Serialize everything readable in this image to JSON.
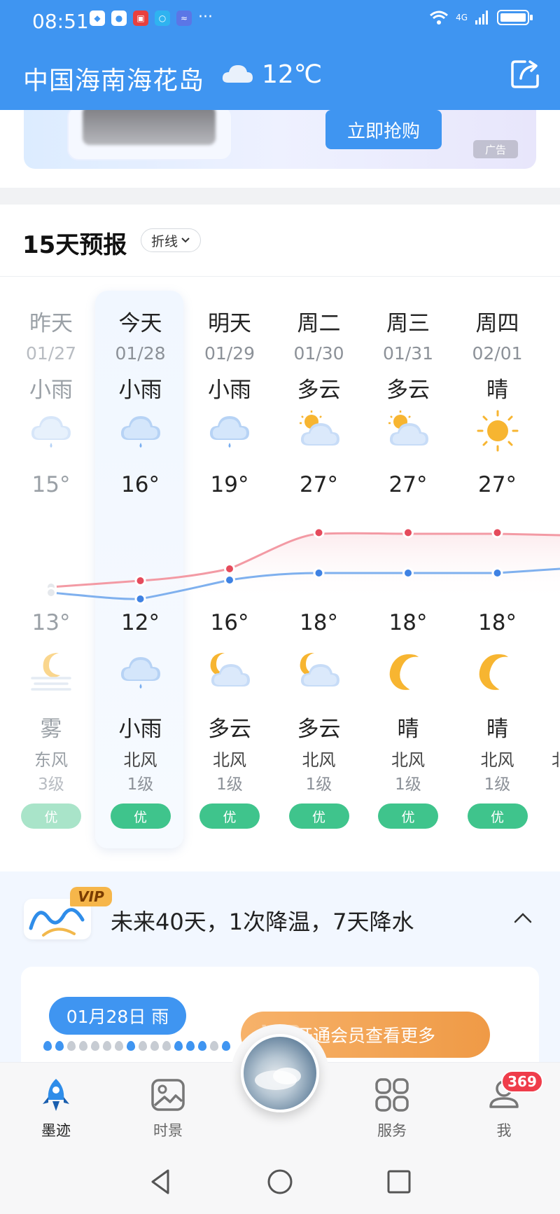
{
  "status_bar": {
    "time": "08:51",
    "network": "4G"
  },
  "header": {
    "location": "中国海南海花岛",
    "current_temp": "12℃",
    "weather_icon": "cloud-icon"
  },
  "ad": {
    "button": "立即抢购",
    "tag": "广告"
  },
  "forecast": {
    "title": "15天预报",
    "view_toggle": "折线",
    "days": [
      {
        "name": "昨天",
        "date": "01/27",
        "day_cond": "小雨",
        "day_icon": "rain-cloud-icon",
        "high": "15°",
        "low": "13°",
        "night_icon": "fog-moon-icon",
        "night_cond": "雾",
        "wind": "东风",
        "wind_level": "3级",
        "aqi": "优"
      },
      {
        "name": "今天",
        "date": "01/28",
        "day_cond": "小雨",
        "day_icon": "rain-cloud-icon",
        "high": "16°",
        "low": "12°",
        "night_icon": "rain-cloud-icon",
        "night_cond": "小雨",
        "wind": "北风",
        "wind_level": "1级",
        "aqi": "优"
      },
      {
        "name": "明天",
        "date": "01/29",
        "day_cond": "小雨",
        "day_icon": "rain-cloud-icon",
        "high": "19°",
        "low": "16°",
        "night_icon": "partly-cloudy-night-icon",
        "night_cond": "多云",
        "wind": "北风",
        "wind_level": "1级",
        "aqi": "优"
      },
      {
        "name": "周二",
        "date": "01/30",
        "day_cond": "多云",
        "day_icon": "partly-cloudy-day-icon",
        "high": "27°",
        "low": "18°",
        "night_icon": "partly-cloudy-night-icon",
        "night_cond": "多云",
        "wind": "北风",
        "wind_level": "1级",
        "aqi": "优"
      },
      {
        "name": "周三",
        "date": "01/31",
        "day_cond": "多云",
        "day_icon": "partly-cloudy-day-icon",
        "high": "27°",
        "low": "18°",
        "night_icon": "moon-icon",
        "night_cond": "晴",
        "wind": "北风",
        "wind_level": "1级",
        "aqi": "优"
      },
      {
        "name": "周四",
        "date": "02/01",
        "day_cond": "晴",
        "day_icon": "sun-icon",
        "high": "27°",
        "low": "18°",
        "night_icon": "moon-icon",
        "night_cond": "晴",
        "wind": "北风",
        "wind_level": "1级",
        "aqi": "优"
      }
    ]
  },
  "forty_day": {
    "vip_badge": "VIP",
    "summary": "未来40天，1次降温，7天降水",
    "date_pill": "01月28日 雨",
    "cta": "开通会员查看更多",
    "cta_watermark": "VIP"
  },
  "bottom_nav": {
    "items": [
      {
        "label": "墨迹",
        "icon": "rocket-icon"
      },
      {
        "label": "时景",
        "icon": "photo-icon"
      },
      {
        "label": "服务",
        "icon": "grid-icon"
      },
      {
        "label": "我",
        "icon": "profile-icon"
      }
    ],
    "badge": "369"
  },
  "colors": {
    "brand": "#3f95f1",
    "aqi_good": "#3fc48c",
    "high_line": "#f07b86",
    "low_line": "#5b9cec"
  }
}
